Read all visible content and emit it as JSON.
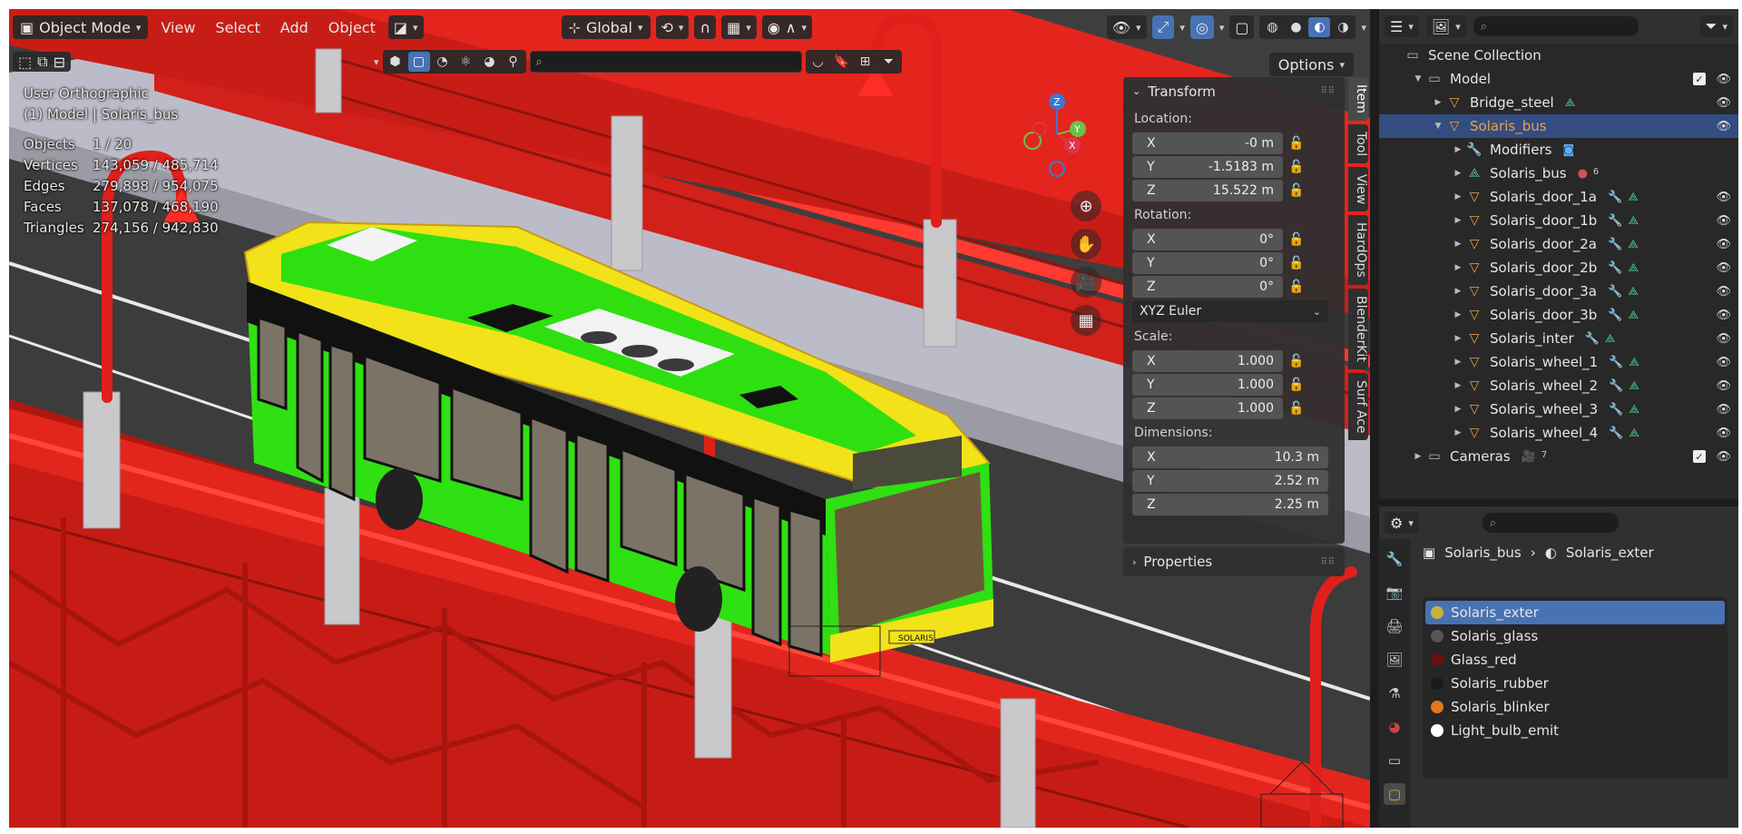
{
  "header": {
    "mode": "Object Mode",
    "menus": [
      "View",
      "Select",
      "Add",
      "Object"
    ],
    "transform_orientation": "Global",
    "options_label": "Options"
  },
  "overlay": {
    "view_name": "User Orthographic",
    "context": "(1) Model | Solaris_bus",
    "stats": [
      {
        "label": "Objects",
        "value": "1 / 20"
      },
      {
        "label": "Vertices",
        "value": "143,059 / 485,714"
      },
      {
        "label": "Edges",
        "value": "279,898 / 954,075"
      },
      {
        "label": "Faces",
        "value": "137,078 / 468,190"
      },
      {
        "label": "Triangles",
        "value": "274,156 / 942,830"
      }
    ],
    "gizmo": {
      "x": "X",
      "y": "Y",
      "z": "Z"
    },
    "bus_brand": "SOLARIS"
  },
  "npanel": {
    "transform_title": "Transform",
    "location_label": "Location:",
    "location": [
      {
        "axis": "X",
        "value": "-0 m"
      },
      {
        "axis": "Y",
        "value": "-1.5183 m"
      },
      {
        "axis": "Z",
        "value": "15.522 m"
      }
    ],
    "rotation_label": "Rotation:",
    "rotation": [
      {
        "axis": "X",
        "value": "0°"
      },
      {
        "axis": "Y",
        "value": "0°"
      },
      {
        "axis": "Z",
        "value": "0°"
      }
    ],
    "rotation_mode": "XYZ Euler",
    "scale_label": "Scale:",
    "scale": [
      {
        "axis": "X",
        "value": "1.000"
      },
      {
        "axis": "Y",
        "value": "1.000"
      },
      {
        "axis": "Z",
        "value": "1.000"
      }
    ],
    "dimensions_label": "Dimensions:",
    "dimensions": [
      {
        "axis": "X",
        "value": "10.3 m"
      },
      {
        "axis": "Y",
        "value": "2.52 m"
      },
      {
        "axis": "Z",
        "value": "2.25 m"
      }
    ],
    "properties_title": "Properties",
    "tabs": [
      "Item",
      "Tool",
      "View",
      "HardOps",
      "BlenderKit",
      "Surf Ace"
    ]
  },
  "outliner": {
    "root": "Scene Collection",
    "rows": [
      {
        "name": "Model",
        "indent": 1,
        "icon": "collection-icon",
        "tri": "▼",
        "chk": true,
        "eye": true
      },
      {
        "name": "Bridge_steel",
        "indent": 2,
        "icon": "mesh-object-icon",
        "tri": "▶",
        "data": true,
        "eye": true
      },
      {
        "name": "Solaris_bus",
        "indent": 2,
        "icon": "mesh-object-icon",
        "tri": "▼",
        "selected": true,
        "eye": true
      },
      {
        "name": "Modifiers",
        "indent": 3,
        "icon": "wrench-icon",
        "tri": "▶",
        "modbadge": true
      },
      {
        "name": "Solaris_bus",
        "indent": 3,
        "icon": "mesh-data-icon",
        "tri": "▶",
        "matbadge": "6"
      },
      {
        "name": "Solaris_door_1a",
        "indent": 3,
        "icon": "mesh-object-icon",
        "tri": "▶",
        "mod": true,
        "eye": true
      },
      {
        "name": "Solaris_door_1b",
        "indent": 3,
        "icon": "mesh-object-icon",
        "tri": "▶",
        "mod": true,
        "eye": true
      },
      {
        "name": "Solaris_door_2a",
        "indent": 3,
        "icon": "mesh-object-icon",
        "tri": "▶",
        "mod": true,
        "eye": true
      },
      {
        "name": "Solaris_door_2b",
        "indent": 3,
        "icon": "mesh-object-icon",
        "tri": "▶",
        "mod": true,
        "eye": true
      },
      {
        "name": "Solaris_door_3a",
        "indent": 3,
        "icon": "mesh-object-icon",
        "tri": "▶",
        "mod": true,
        "eye": true
      },
      {
        "name": "Solaris_door_3b",
        "indent": 3,
        "icon": "mesh-object-icon",
        "tri": "▶",
        "mod": true,
        "eye": true
      },
      {
        "name": "Solaris_inter",
        "indent": 3,
        "icon": "mesh-object-icon",
        "tri": "▶",
        "mod": true,
        "eye": true
      },
      {
        "name": "Solaris_wheel_1",
        "indent": 3,
        "icon": "mesh-object-icon",
        "tri": "▶",
        "mod": true,
        "eye": true
      },
      {
        "name": "Solaris_wheel_2",
        "indent": 3,
        "icon": "mesh-object-icon",
        "tri": "▶",
        "mod": true,
        "eye": true
      },
      {
        "name": "Solaris_wheel_3",
        "indent": 3,
        "icon": "mesh-object-icon",
        "tri": "▶",
        "mod": true,
        "eye": true
      },
      {
        "name": "Solaris_wheel_4",
        "indent": 3,
        "icon": "mesh-object-icon",
        "tri": "▶",
        "mod": true,
        "eye": true
      },
      {
        "name": "Cameras",
        "indent": 1,
        "icon": "collection-icon",
        "tri": "▶",
        "cambadge": "7",
        "chk": true,
        "eye": true
      }
    ]
  },
  "properties": {
    "breadcrumb_object": "Solaris_bus",
    "breadcrumb_material": "Solaris_exter",
    "materials": [
      {
        "name": "Solaris_exter",
        "color": "#c8b040",
        "selected": true
      },
      {
        "name": "Solaris_glass",
        "color": "#555555"
      },
      {
        "name": "Glass_red",
        "color": "#6a1010"
      },
      {
        "name": "Solaris_rubber",
        "color": "#1a1a1a"
      },
      {
        "name": "Solaris_blinker",
        "color": "#e07820"
      },
      {
        "name": "Light_bulb_emit",
        "color": "#ffffff"
      }
    ]
  },
  "colors": {
    "accent": "#4772b3",
    "selected_row": "#334d80",
    "bridge_red": "#e0261e",
    "bus_green": "#33dd11",
    "bus_yellow": "#f2e21a"
  }
}
